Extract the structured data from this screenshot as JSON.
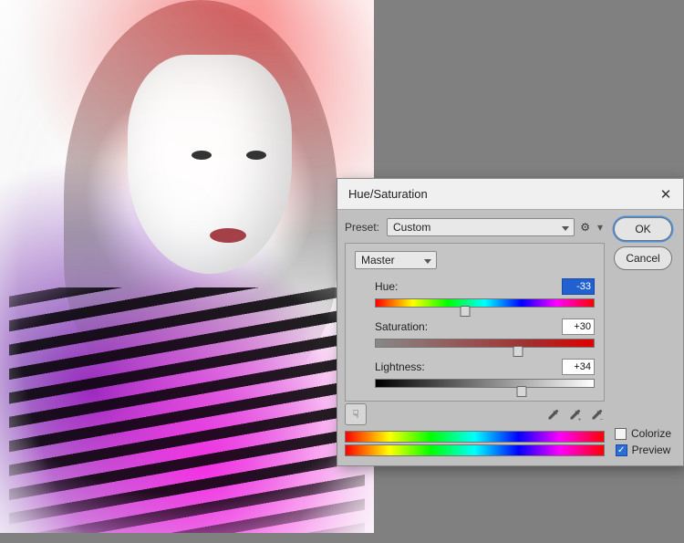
{
  "dialog": {
    "title": "Hue/Saturation",
    "preset_label": "Preset:",
    "preset_value": "Custom",
    "range_value": "Master",
    "hue_label": "Hue:",
    "hue_value": "-33",
    "sat_label": "Saturation:",
    "sat_value": "+30",
    "light_label": "Lightness:",
    "light_value": "+34",
    "ok": "OK",
    "cancel": "Cancel",
    "colorize": "Colorize",
    "preview": "Preview"
  },
  "state": {
    "hue_pct": 41,
    "sat_pct": 65,
    "light_pct": 67,
    "colorize_checked": false,
    "preview_checked": true
  }
}
